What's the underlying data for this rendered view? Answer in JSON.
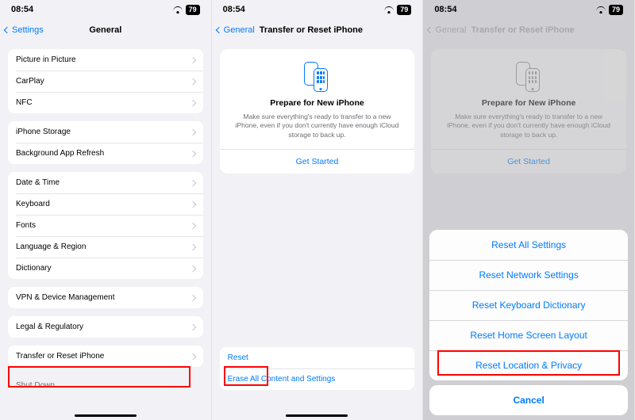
{
  "status": {
    "time": "08:54",
    "battery": "79"
  },
  "screen1": {
    "back": "Settings",
    "title": "General",
    "groups": [
      [
        "Picture in Picture",
        "CarPlay",
        "NFC"
      ],
      [
        "iPhone Storage",
        "Background App Refresh"
      ],
      [
        "Date & Time",
        "Keyboard",
        "Fonts",
        "Language & Region",
        "Dictionary"
      ],
      [
        "VPN & Device Management"
      ],
      [
        "Legal & Regulatory"
      ],
      [
        "Transfer or Reset iPhone"
      ],
      [
        "Shut Down"
      ]
    ]
  },
  "screen2": {
    "back": "General",
    "title": "Transfer or Reset iPhone",
    "card": {
      "title": "Prepare for New iPhone",
      "desc": "Make sure everything's ready to transfer to a new iPhone, even if you don't currently have enough iCloud storage to back up.",
      "action": "Get Started"
    },
    "bottom": [
      "Reset",
      "Erase All Content and Settings"
    ]
  },
  "screen3": {
    "back": "General",
    "title": "Transfer or Reset iPhone",
    "card": {
      "title": "Prepare for New iPhone",
      "desc": "Make sure everything's ready to transfer to a new iPhone, even if you don't currently have enough iCloud storage to back up.",
      "action": "Get Started"
    },
    "sheet": {
      "items": [
        "Reset All Settings",
        "Reset Network Settings",
        "Reset Keyboard Dictionary",
        "Reset Home Screen Layout",
        "Reset Location & Privacy"
      ],
      "cancel": "Cancel"
    }
  }
}
